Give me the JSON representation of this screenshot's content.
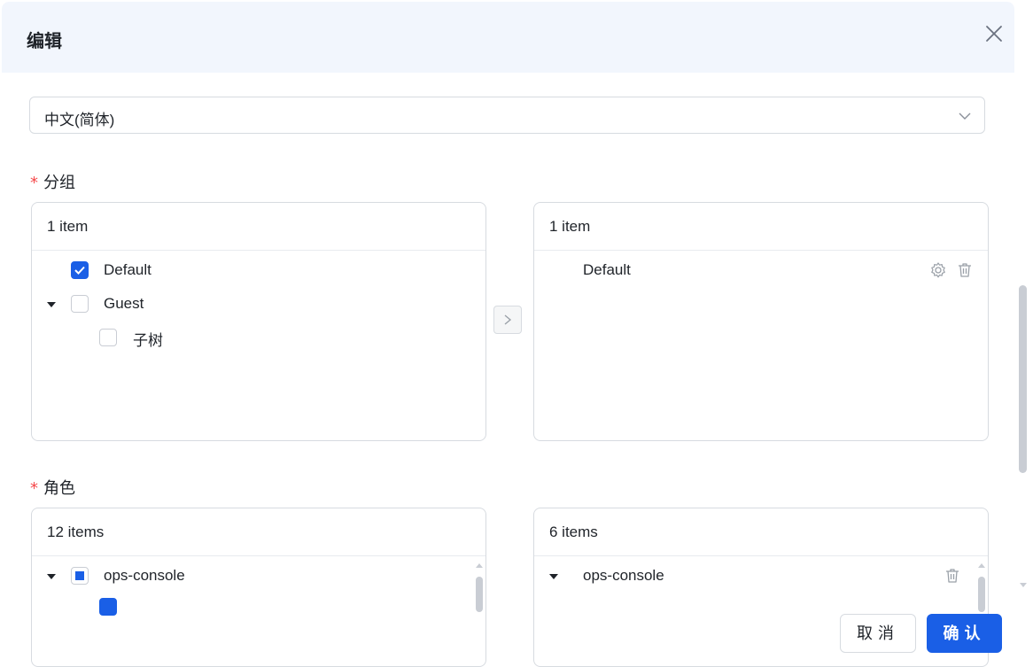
{
  "dialog": {
    "title": "编辑",
    "language_select": {
      "value": "中文(简体)"
    },
    "group_section": {
      "label": "分组",
      "required_mark": "*",
      "source": {
        "count": "1 item",
        "items": [
          {
            "label": "Default",
            "checked": true
          },
          {
            "label": "Guest",
            "checked": false,
            "expanded": true
          },
          {
            "label": "子树",
            "checked": false
          }
        ]
      },
      "target": {
        "count": "1 item",
        "items": [
          {
            "label": "Default"
          }
        ]
      }
    },
    "role_section": {
      "label": "角色",
      "required_mark": "*",
      "source": {
        "count": "12 items",
        "items": [
          {
            "label": "ops-console",
            "state": "indeterminate",
            "expanded": true
          }
        ]
      },
      "target": {
        "count": "6 items",
        "items": [
          {
            "label": "ops-console",
            "expanded": true
          }
        ]
      }
    },
    "footer": {
      "cancel_label": "取消",
      "ok_label": "确认"
    }
  },
  "colors": {
    "primary": "#1a5fe6",
    "required": "#f5484a",
    "header_bg": "#f2f6fd"
  },
  "icons": [
    "close-icon",
    "chevron-down-icon",
    "chevron-right-icon",
    "gear-icon",
    "trash-icon",
    "check-icon",
    "caret-down-icon"
  ]
}
